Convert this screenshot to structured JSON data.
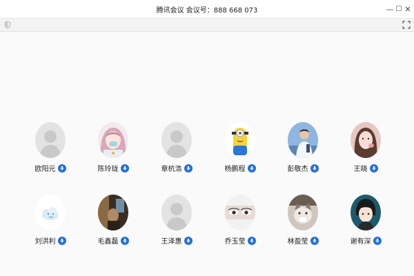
{
  "window": {
    "title": "腾讯会议 会议号：888 668 073",
    "minimize_glyph": "—",
    "maximize_glyph": "☐",
    "close_glyph": "✕"
  },
  "colors": {
    "mic_blue": "#1f6fe0",
    "placeholder_gray": "#e3e3e3",
    "placeholder_figure": "#c9c9c9"
  },
  "participants": [
    {
      "name": "欧阳元",
      "avatar": "placeholder"
    },
    {
      "name": "陈玲珑",
      "avatar": "anime-girl"
    },
    {
      "name": "章杭浩",
      "avatar": "placeholder"
    },
    {
      "name": "杨鹏程",
      "avatar": "minion"
    },
    {
      "name": "彭敬杰",
      "avatar": "photo-man"
    },
    {
      "name": "王晓",
      "avatar": "photo-girl"
    },
    {
      "name": "刘洪利",
      "avatar": "cloud-cartoon"
    },
    {
      "name": "毛鑫磊",
      "avatar": "photo-dark"
    },
    {
      "name": "王泽惠",
      "avatar": "placeholder"
    },
    {
      "name": "乔玉莹",
      "avatar": "eyes"
    },
    {
      "name": "林盈莹",
      "avatar": "cat"
    },
    {
      "name": "谢有深",
      "avatar": "anime-boy"
    }
  ]
}
